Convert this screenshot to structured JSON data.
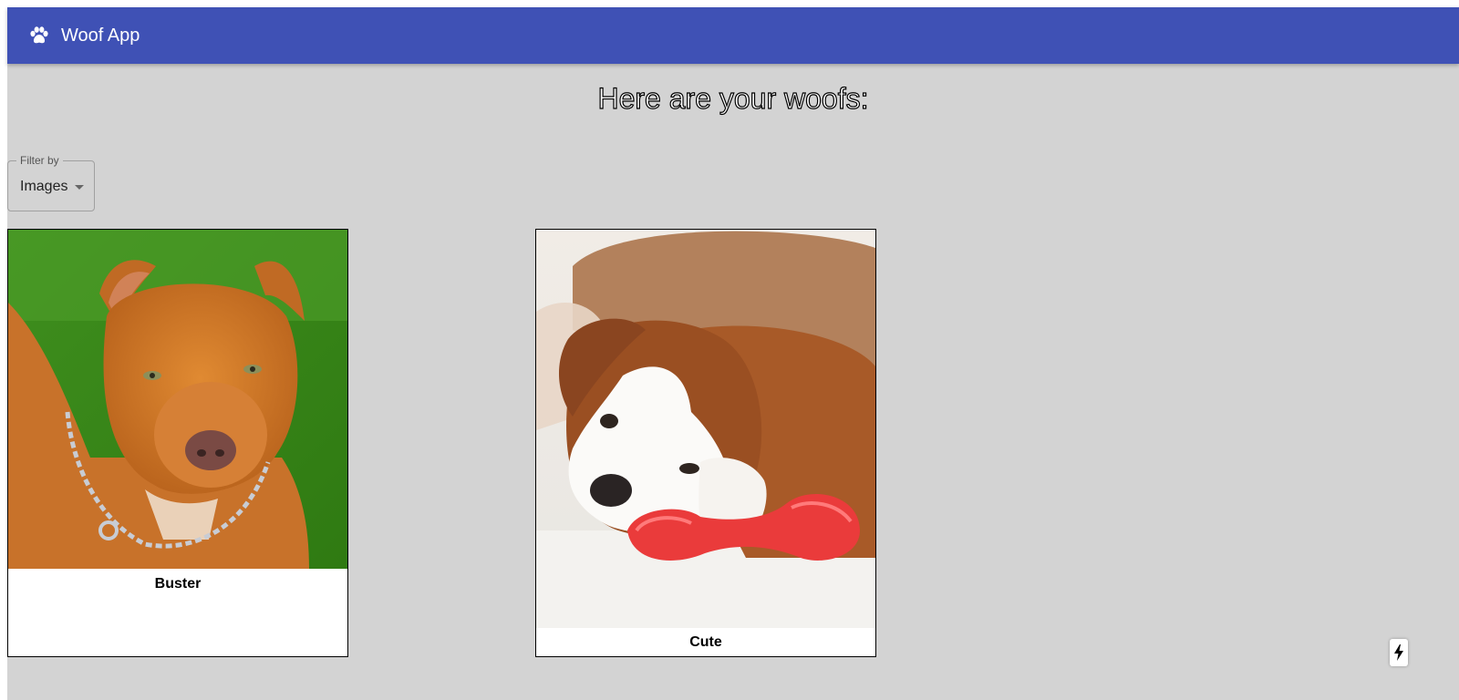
{
  "app": {
    "title": "Woof App",
    "brand_color": "#3f51b5",
    "background_color": "#d3d3d3"
  },
  "main": {
    "heading": "Here are your woofs:"
  },
  "filter": {
    "legend": "Filter by",
    "value": "Images"
  },
  "cards": [
    {
      "caption": "Buster",
      "image": "orange-pitbull-with-chain-collar"
    },
    {
      "caption": "Cute",
      "image": "bulldog-puppy-with-red-toy"
    }
  ],
  "icons": {
    "logo": "paw-icon",
    "floating": "lightning-bolt-icon",
    "dropdown": "caret-down-icon"
  }
}
